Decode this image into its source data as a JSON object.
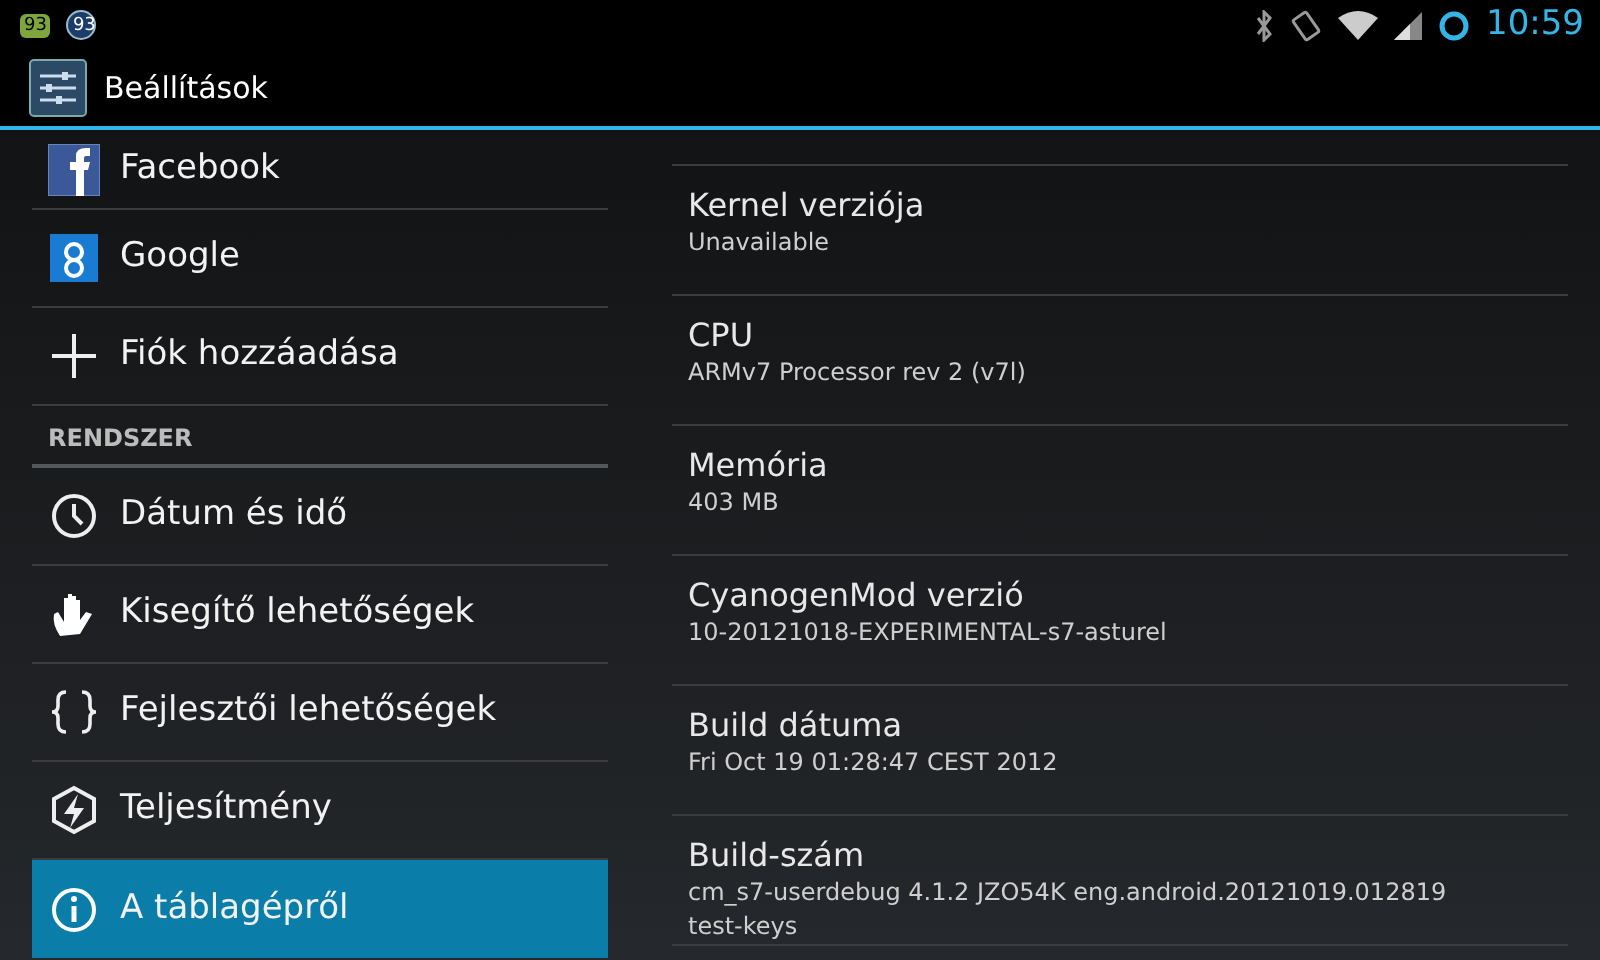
{
  "status_bar": {
    "notifications": [
      "93",
      "93"
    ],
    "time": "10:59"
  },
  "action_bar": {
    "title": "Beállítások"
  },
  "sidebar": {
    "items": [
      {
        "kind": "facebook",
        "label": "Facebook",
        "selected": false
      },
      {
        "kind": "google",
        "label": "Google",
        "selected": false
      },
      {
        "kind": "plus",
        "label": "Fiók hozzáadása",
        "selected": false
      },
      {
        "kind": "header",
        "label": "RENDSZER"
      },
      {
        "kind": "clock",
        "label": "Dátum és idő",
        "selected": false
      },
      {
        "kind": "hand",
        "label": "Kisegítő lehetőségek",
        "selected": false
      },
      {
        "kind": "braces",
        "label": "Fejlesztői lehetőségek",
        "selected": false
      },
      {
        "kind": "bolt",
        "label": "Teljesítmény",
        "selected": false
      },
      {
        "kind": "info",
        "label": "A táblagépről",
        "selected": true
      }
    ]
  },
  "details": [
    {
      "title": "Kernel verziója",
      "lines": [
        "Unavailable"
      ]
    },
    {
      "title": "CPU",
      "lines": [
        "ARMv7 Processor rev 2 (v7l)"
      ]
    },
    {
      "title": "Memória",
      "lines": [
        "403 MB"
      ]
    },
    {
      "title": "CyanogenMod verzió",
      "lines": [
        "10-20121018-EXPERIMENTAL-s7-asturel"
      ]
    },
    {
      "title": "Build dátuma",
      "lines": [
        "Fri Oct 19 01:28:47 CEST 2012"
      ]
    },
    {
      "title": "Build-szám",
      "lines": [
        "cm_s7-userdebug 4.1.2 JZO54K eng.android.20121019.012819",
        "test-keys"
      ]
    }
  ]
}
